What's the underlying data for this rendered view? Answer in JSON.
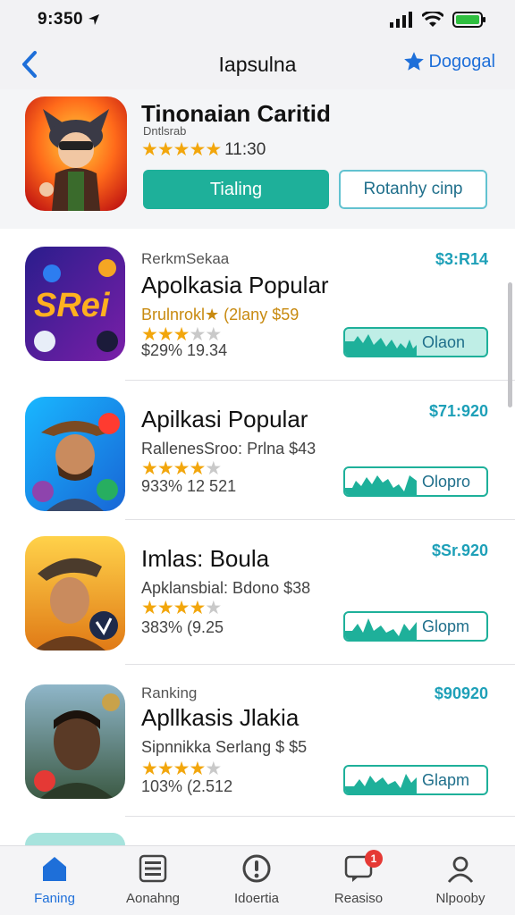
{
  "status_bar": {
    "time": "9:350"
  },
  "nav": {
    "title": "Iapsulna",
    "action_label": "Dogogal"
  },
  "featured": {
    "name": "Tinonaian Caritid",
    "developer": "Dntlsrab",
    "rating_text": "11:30",
    "stars_filled": 5,
    "primary_button": "Tialing",
    "secondary_button": "Rotanhy cinp"
  },
  "apps": [
    {
      "meta": "RerkmSekaa",
      "name": "Apolkasia Popular",
      "subtitle": "Brulnrokl★ (2lany   $59",
      "count": "$29% 19.34",
      "price": "$3:R14",
      "button": "Olaon",
      "stars_filled": 3
    },
    {
      "meta": "",
      "name": "Apilkasi Popular",
      "subtitle": "RallenesSroo: Prlna  $43",
      "count": "933% 12 521",
      "price": "$71:920",
      "button": "Olopro",
      "stars_filled": 4
    },
    {
      "meta": "",
      "name": "Imlas: Boula",
      "subtitle": "Apklansbial: Bdono  $38",
      "count": "383% (9.25",
      "price": "$Sr.920",
      "button": "Glopm",
      "stars_filled": 4
    },
    {
      "meta": "Ranking",
      "name": "Apllkasis Jlakia",
      "subtitle": "Sipnnikka Serlang  $ $5",
      "count": "103% (2.512",
      "price": "$90920",
      "button": "Glapm",
      "stars_filled": 4
    }
  ],
  "tabs": [
    {
      "label": "Faning",
      "icon": "home-icon",
      "active": true
    },
    {
      "label": "Aonahng",
      "icon": "list-icon",
      "active": false
    },
    {
      "label": "Idoertia",
      "icon": "alert-circle-icon",
      "active": false
    },
    {
      "label": "Reasiso",
      "icon": "chat-icon",
      "active": false,
      "badge": "1"
    },
    {
      "label": "Nlpooby",
      "icon": "user-icon",
      "active": false
    }
  ],
  "colors": {
    "accent": "#1eb09a",
    "link": "#1e6fd9",
    "price": "#1ea0b8",
    "star": "#f2a60c"
  }
}
